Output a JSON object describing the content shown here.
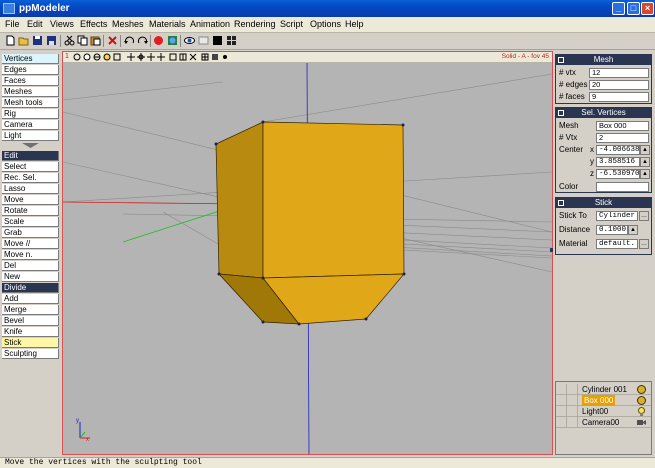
{
  "app": {
    "title": "ppModeler"
  },
  "menu": [
    "File",
    "Edit",
    "Views",
    "Effects",
    "Meshes",
    "Materials",
    "Animation",
    "Rendering",
    "Script",
    "Options",
    "Help"
  ],
  "toolbar_icons": [
    "new-icon",
    "open-icon",
    "save-icon",
    "save-as-icon",
    "cut-icon",
    "copy-icon",
    "paste-icon",
    "delete-icon",
    "undo-icon",
    "redo-icon",
    "record-icon",
    "material-icon",
    "view-icon",
    "wireframe-icon",
    "black-square-icon",
    "grid-icon"
  ],
  "left_panel": {
    "modes": [
      "Vertices",
      "Edges",
      "Faces",
      "Meshes",
      "Mesh tools",
      "Rig",
      "Camera",
      "Light"
    ],
    "tools": [
      "Edit",
      "Select",
      "Rec. Sel.",
      "Lasso",
      "Move",
      "Rotate",
      "Scale",
      "Grab",
      "Move //",
      "Move n.",
      "Del",
      "New",
      "Divide",
      "Add",
      "Merge",
      "Bevel",
      "Knife",
      "Stick",
      "Sculpting"
    ]
  },
  "viewport": {
    "view_number": "1",
    "info": "Solid - A - fov 45"
  },
  "mesh_panel": {
    "title": "Mesh",
    "rows": [
      {
        "label": "# vtx",
        "value": "12"
      },
      {
        "label": "# edges",
        "value": "20"
      },
      {
        "label": "# faces",
        "value": "9"
      }
    ]
  },
  "sel_vertices_panel": {
    "title": "Sel. Vertices",
    "mesh_label": "Mesh",
    "mesh_value": "Box 000",
    "vtx_label": "# Vtx",
    "vtx_value": "2",
    "center_label": "Center",
    "x_label": "x",
    "x_value": "-4.006638",
    "y_label": "y",
    "y_value": "3.858516",
    "z_label": "z",
    "z_value": "-6.530970",
    "color_label": "Color"
  },
  "stick_panel": {
    "title": "Stick",
    "stick_to_label": "Stick To",
    "stick_to_value": "Cylinder",
    "distance_label": "Distance",
    "distance_value": "0.1000",
    "material_label": "Material",
    "material_value": "default."
  },
  "scene_list": [
    {
      "name": "Cylinder 001",
      "icon": "mesh-icon",
      "selected": false
    },
    {
      "name": "Box 000",
      "icon": "mesh-icon",
      "selected": true
    },
    {
      "name": "Light00",
      "icon": "light-bulb-icon",
      "selected": false
    },
    {
      "name": "Camera00",
      "icon": "camera-icon",
      "selected": false
    }
  ],
  "status": "Move the vertices with the sculpting tool",
  "colors": {
    "selected_object": "#e8a000",
    "mesh_face_front": "#e0a818",
    "mesh_face_side": "#b88a10",
    "viewport_bg": "#b4b4b4",
    "panel_header": "#2a3552"
  }
}
